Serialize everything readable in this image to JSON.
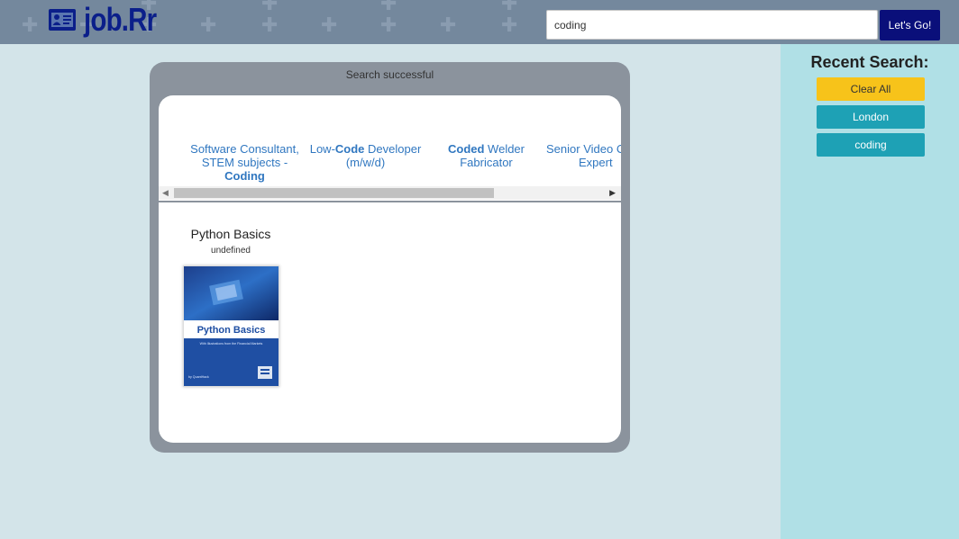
{
  "header": {
    "logo_text": "job.Rr",
    "search_value": "coding",
    "search_placeholder": "",
    "go_label": "Let's Go!"
  },
  "sidebar": {
    "title": "Recent Search:",
    "clear_label": "Clear All",
    "recent": [
      "London",
      "coding"
    ]
  },
  "results": {
    "status": "Search successful",
    "jobs": [
      {
        "before": "Software Consultant, STEM subjects - ",
        "highlight": "Coding",
        "after": ""
      },
      {
        "before": "Low-",
        "highlight": "Code",
        "after": " Developer (m/w/d)"
      },
      {
        "before": "",
        "highlight": "Coded",
        "after": " Welder Fabricator"
      },
      {
        "before": "Senior Video C",
        "highlight": "",
        "after": "Expert"
      }
    ],
    "course": {
      "title": "Python Basics",
      "subtitle": "undefined",
      "cover_title": "Python Basics",
      "cover_subtitle": "With Illustrations from the Financial Markets",
      "cover_author": "by QuantHack"
    }
  },
  "colors": {
    "header_bg": "#74889d",
    "logo": "#0b1f8a",
    "go_button": "#0a0f7a",
    "clear_button": "#f7c31a",
    "recent_button": "#1ea1b5",
    "sidebar_bg": "#b0e0e6",
    "page_bg": "#d3e4e9",
    "link": "#3077c0"
  },
  "icons": {
    "logo": "id-card-icon",
    "scroll_left": "arrow-left-icon",
    "scroll_right": "arrow-right-icon"
  }
}
